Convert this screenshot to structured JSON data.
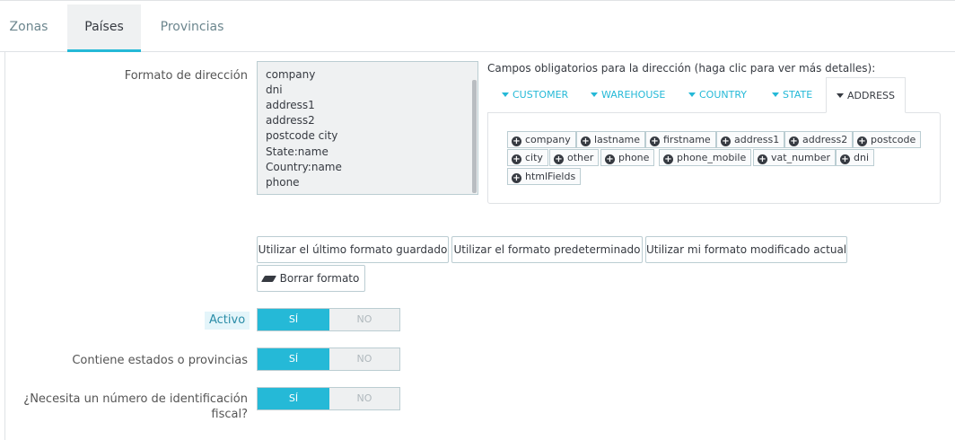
{
  "tabs": [
    {
      "label": "Zonas"
    },
    {
      "label": "Países"
    },
    {
      "label": "Provincias"
    }
  ],
  "address_format": {
    "label": "Formato de dirección",
    "lines": [
      "company",
      "dni",
      "address1",
      "address2",
      "postcode city",
      "State:name",
      "Country:name",
      "phone"
    ]
  },
  "required_fields": {
    "title": "Campos obligatorios para la dirección (haga clic para ver más detalles):",
    "subtabs": [
      {
        "label": "CUSTOMER"
      },
      {
        "label": "WAREHOUSE"
      },
      {
        "label": "COUNTRY"
      },
      {
        "label": "STATE"
      },
      {
        "label": "ADDRESS"
      }
    ],
    "fields": [
      "company",
      "lastname",
      "firstname",
      "address1",
      "address2",
      "postcode",
      "city",
      "other",
      "phone",
      "phone_mobile",
      "vat_number",
      "dni",
      "htmlFields"
    ]
  },
  "buttons": {
    "last_saved": "Utilizar el último formato guardado",
    "default": "Utilizar el formato predeterminado",
    "current": "Utilizar mi formato modificado actual",
    "clear": "Borrar formato"
  },
  "switches": [
    {
      "label": "Activo",
      "yes": "SÍ",
      "no": "NO"
    },
    {
      "label": "Contiene estados o provincias",
      "yes": "SÍ",
      "no": "NO"
    },
    {
      "label_line1": "¿Necesita un número de identificación",
      "label_line2": "fiscal?",
      "yes": "SÍ",
      "no": "NO"
    }
  ],
  "colors": {
    "accent": "#25b9d7",
    "text": "#363a41",
    "muted": "#6c868e"
  }
}
